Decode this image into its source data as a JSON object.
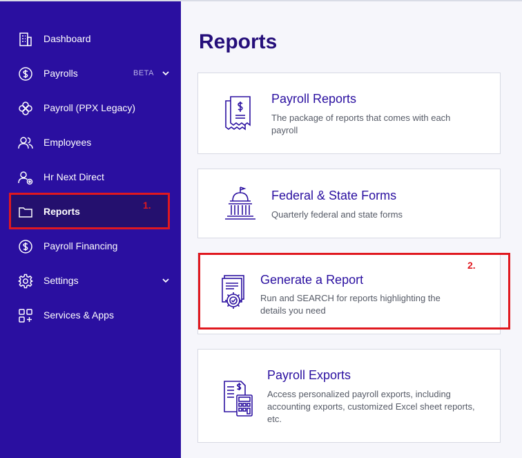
{
  "sidebar": {
    "items": [
      {
        "label": "Dashboard"
      },
      {
        "label": "Payrolls",
        "badge": "BETA"
      },
      {
        "label": "Payroll (PPX Legacy)"
      },
      {
        "label": "Employees"
      },
      {
        "label": "Hr Next Direct"
      },
      {
        "label": "Reports"
      },
      {
        "label": "Payroll Financing"
      },
      {
        "label": "Settings"
      },
      {
        "label": "Services & Apps"
      }
    ]
  },
  "main": {
    "title": "Reports",
    "cards": [
      {
        "title": "Payroll Reports",
        "description": "The package of reports that comes with each payroll"
      },
      {
        "title": "Federal & State Forms",
        "description": "Quarterly federal and state forms"
      },
      {
        "title": "Generate a Report",
        "description": "Run and SEARCH for reports highlighting the details you need"
      },
      {
        "title": "Payroll Exports",
        "description": "Access personalized payroll exports, including accounting exports, customized Excel sheet reports, etc."
      }
    ]
  },
  "annotations": [
    "1.",
    "2."
  ],
  "colors": {
    "sidebar_bg": "#2a0fa0",
    "active_bg": "#24106e",
    "heading": "#250e7a",
    "highlight": "#e0181f"
  }
}
